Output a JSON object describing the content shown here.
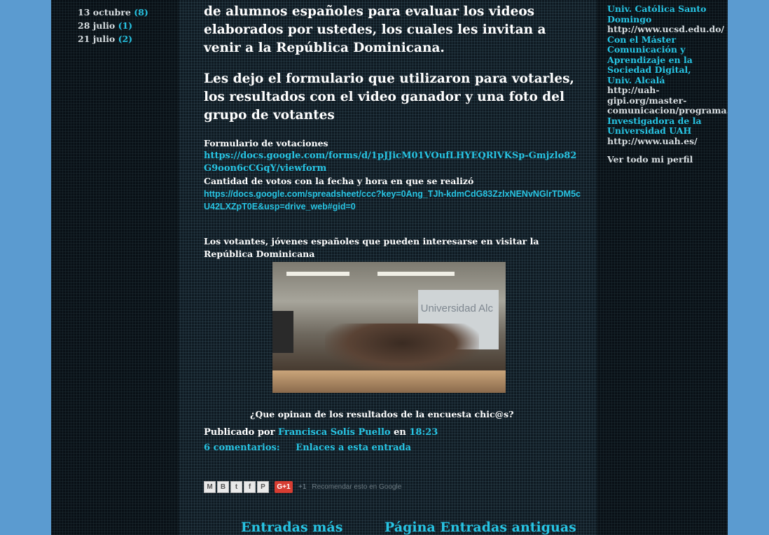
{
  "archive": [
    {
      "label": "13 octubre",
      "count": "(8)"
    },
    {
      "label": "28 julio",
      "count": "(1)"
    },
    {
      "label": "21 julio",
      "count": "(2)"
    }
  ],
  "post": {
    "para1": "de alumnos españoles para evaluar los videos elaborados por ustedes, los cuales les invitan a venir a la República Dominicana.",
    "para2": "Les dejo el formulario que utilizaron para votarles, los resultados con el video ganador y una foto del grupo de votantes",
    "form_label": "Formulario de votaciones",
    "form_url": "https://docs.google.com/forms/d/1pJJicM01VOufLHYEQRlVKSp-Gmjzlo82G9oon6cCGqY/viewform",
    "votes_label": "Cantidad de votos con la fecha y hora en que se realizó",
    "votes_url": "https://docs.google.com/spreadsheet/ccc?key=0Ang_TJh-kdmCdG83ZzlxNENvNGlrTDM5cU42LXZpT0E&usp=drive_web#gid=0",
    "voters_text": "Los votantes, jóvenes españoles que pueden interesarse en visitar la República Dominicana",
    "photo_board_text": "Universidad Alc",
    "question": "¿Que opinan de los resultados de la encuesta chic@s?"
  },
  "footer": {
    "published_by": "Publicado por",
    "author": "Francisca Solís Puello",
    "at": "en",
    "time": "18:23",
    "comments": "6 comentarios:",
    "links": "Enlaces a esta entrada"
  },
  "share": {
    "buttons": [
      "M",
      "B",
      "t",
      "f",
      "P"
    ],
    "gplus": "G+1",
    "plus1": "+1",
    "recommend": "Recomendar esto en Google"
  },
  "pager": {
    "newer": "Entradas más",
    "home_older": "Página Entradas antiguas"
  },
  "profile": {
    "l1_link": "Univ. Católica Santo Domingo",
    "l1_text": "http://www.ucsd.edu.do/",
    "l2_link": "Con el Máster Comunicación y Aprendizaje en la Sociedad Digital, Univ. Alcalá",
    "l2_text": "http://uah-gipi.org/master-comunicacion/programa.php",
    "l3_link": "Investigadora de la Universidad UAH",
    "l3_text": "http://www.uah.es/",
    "see_all": "Ver todo mi perfil"
  }
}
